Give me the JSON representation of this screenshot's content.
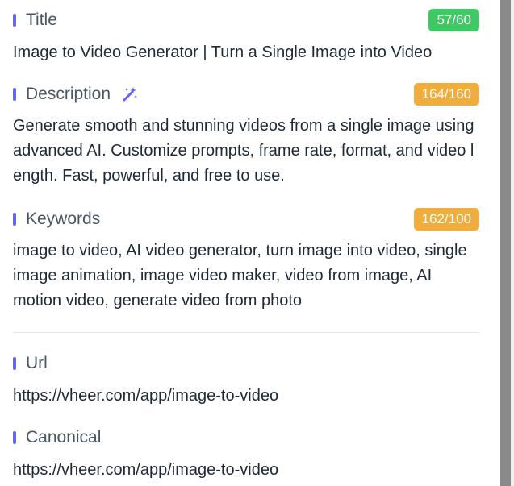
{
  "title": {
    "label": "Title",
    "count": "57/60",
    "value": "Image to Video Generator | Turn a Single Image into Video"
  },
  "description": {
    "label": "Description",
    "count": "164/160",
    "value": "Generate smooth and stunning videos from a single image using advanced AI. Customize prompts, frame rate, format, and video length. Fast, powerful, and free to use."
  },
  "keywords": {
    "label": "Keywords",
    "count": "162/100",
    "value": "image to video, AI video generator, turn image into video, single image animation, image video maker, video from image, AI motion video, generate video from photo"
  },
  "url": {
    "label": "Url",
    "value": "https://vheer.com/app/image-to-video"
  },
  "canonical": {
    "label": "Canonical",
    "value": "https://vheer.com/app/image-to-video"
  },
  "colors": {
    "accent": "#6366f1",
    "ok": "#3fc965",
    "warn": "#f0ad3c"
  }
}
